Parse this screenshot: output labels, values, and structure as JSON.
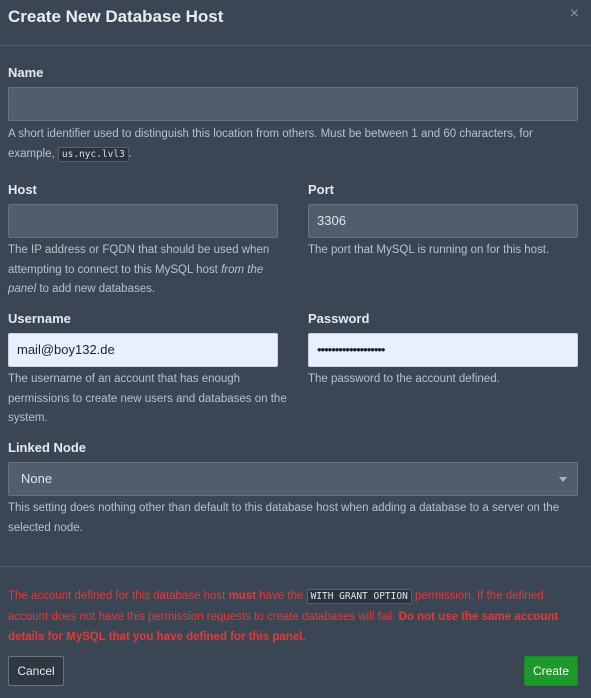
{
  "modal": {
    "title": "Create New Database Host",
    "close_glyph": "×"
  },
  "fields": {
    "name": {
      "label": "Name",
      "value": "",
      "help_text": "A short identifier used to distinguish this location from others. Must be between 1 and 60 characters, for example,",
      "help_code": "us.nyc.lvl3",
      "help_suffix": "."
    },
    "host": {
      "label": "Host",
      "value": "",
      "help_before": "The IP address or FQDN that should be used when attempting to connect to this MySQL host ",
      "help_emphasis": "from the panel",
      "help_after": " to add new databases."
    },
    "port": {
      "label": "Port",
      "value": "3306",
      "help": "The port that MySQL is running on for this host."
    },
    "username": {
      "label": "Username",
      "value": "mail@boy132.de",
      "help": "The username of an account that has enough permissions to create new users and databases on the system."
    },
    "password": {
      "label": "Password",
      "value": "•••••••••••••••••••",
      "help": "The password to the account defined."
    },
    "linked_node": {
      "label": "Linked Node",
      "selected": "None",
      "help": "This setting does nothing other than default to this database host when adding a database to a server on the selected node."
    }
  },
  "warning": {
    "part1": "The account defined for this database host ",
    "must": "must",
    "part2": " have the ",
    "code": "WITH GRANT OPTION",
    "part3": " permission. If the defined account does not have this permission requests to create databases will fail. ",
    "bold_end": "Do not use the same account details for MySQL that you have defined for this panel."
  },
  "buttons": {
    "cancel": "Cancel",
    "create": "Create"
  },
  "colors": {
    "background": "#3a4653",
    "input": "#515d6a",
    "warning": "#e13b3b",
    "create_button": "#1e9a2b"
  },
  "icons": {
    "close": "close-icon",
    "select_caret": "chevron-down-icon"
  }
}
